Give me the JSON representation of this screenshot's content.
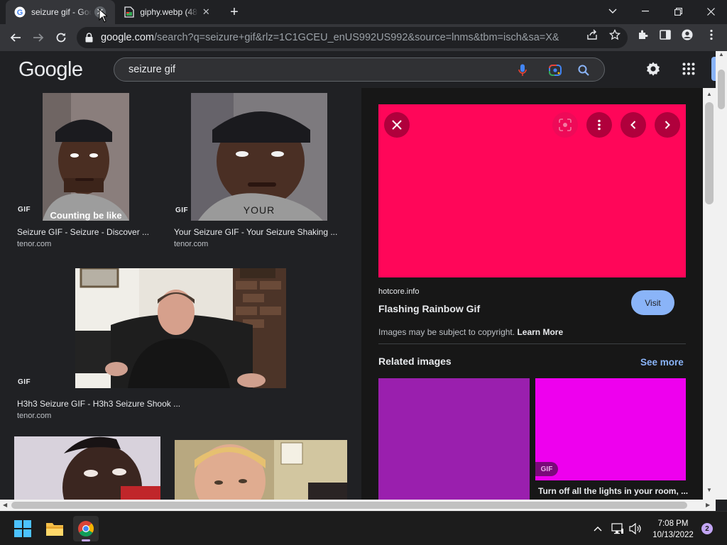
{
  "browser": {
    "tabs": [
      {
        "title": "seizure gif - Goo",
        "favicon": "google-g-icon",
        "active": true
      },
      {
        "title": "giphy.webp (480",
        "favicon": "file-image-icon",
        "active": false
      }
    ],
    "new_tab": "+",
    "url_host": "google.com",
    "url_path": "/search?q=seizure+gif&rlz=1C1GCEU_enUS992US992&source=lnms&tbm=isch&sa=X&ved=2..."
  },
  "google": {
    "logo": "Google",
    "query": "seizure gif"
  },
  "results": [
    {
      "title": "Seizure GIF - Seizure - Discover ...",
      "source": "tenor.com",
      "badge": "GIF",
      "caption": "Counting be like"
    },
    {
      "title": "Your Seizure GIF - Your Seizure Shaking ...",
      "source": "tenor.com",
      "badge": "GIF",
      "caption": "YOUR"
    },
    {
      "title": "H3h3 Seizure GIF - H3h3 Seizure Shook ...",
      "source": "tenor.com",
      "badge": "GIF"
    }
  ],
  "panel": {
    "source": "hotcore.info",
    "title": "Flashing Rainbow Gif",
    "visit_label": "Visit",
    "copyright_text": "Images may be subject to copyright.",
    "learn_more": "Learn More",
    "related_title": "Related images",
    "see_more": "See more",
    "related": [
      {
        "color": "#9a1fae"
      },
      {
        "color": "#ee00ee",
        "badge": "GIF",
        "caption": "Turn off all the lights in your room, ..."
      }
    ],
    "preview_color": "#ff0659"
  },
  "taskbar": {
    "time": "7:08 PM",
    "date": "10/13/2022",
    "notifications": "2"
  }
}
